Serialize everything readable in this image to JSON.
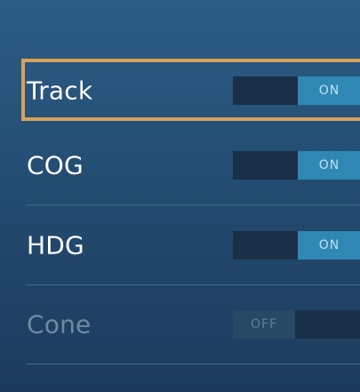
{
  "settings": {
    "items": [
      {
        "label": "Track",
        "toggle": "ON"
      },
      {
        "label": "COG",
        "toggle": "ON"
      },
      {
        "label": "HDG",
        "toggle": "ON"
      },
      {
        "label": "Cone",
        "toggle": "OFF"
      }
    ]
  },
  "colors": {
    "focus_border": "#d7a25b",
    "toggle_on": "#2f87b4",
    "toggle_off": "#284964",
    "toggle_track": "#1a3048",
    "background_top": "#2c5d85",
    "background_bottom": "#1c3b5c"
  }
}
